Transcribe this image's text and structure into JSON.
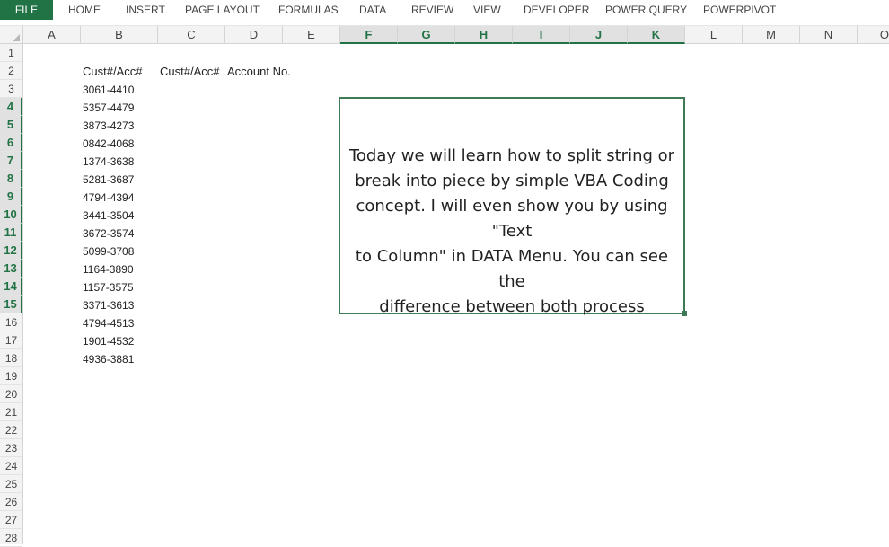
{
  "ribbon": {
    "tabs": [
      "FILE",
      "HOME",
      "INSERT",
      "PAGE LAYOUT",
      "FORMULAS",
      "DATA",
      "REVIEW",
      "VIEW",
      "DEVELOPER",
      "POWER QUERY",
      "POWERPIVOT"
    ]
  },
  "columns": [
    "A",
    "B",
    "C",
    "D",
    "E",
    "F",
    "G",
    "H",
    "I",
    "J",
    "K",
    "L",
    "M",
    "N",
    "O"
  ],
  "selected_columns": [
    "F",
    "G",
    "H",
    "I",
    "J",
    "K"
  ],
  "rows": [
    "1",
    "2",
    "3",
    "4",
    "5",
    "6",
    "7",
    "8",
    "9",
    "10",
    "11",
    "12",
    "13",
    "14",
    "15",
    "16",
    "17",
    "18",
    "19",
    "20",
    "21",
    "22",
    "23",
    "24",
    "25",
    "26",
    "27",
    "28"
  ],
  "selected_rows": [
    "4",
    "5",
    "6",
    "7",
    "8",
    "9",
    "10",
    "11",
    "12",
    "13",
    "14",
    "15"
  ],
  "headers": {
    "b2": "Cust#/Acc#",
    "c2": "Cust#/Acc#",
    "d2": "Account No."
  },
  "data_b": [
    "3061-4410",
    "5357-4479",
    "3873-4273",
    "0842-4068",
    "1374-3638",
    "5281-3687",
    "4794-4394",
    "3441-3504",
    "3672-3574",
    "5099-3708",
    "1164-3890",
    "1157-3575",
    "3371-3613",
    "4794-4513",
    "1901-4532",
    "4936-3881"
  ],
  "textbox": {
    "lines": [
      "Today we will learn how to split string or",
      "break into piece by simple VBA Coding",
      "concept. I will even show you by using \"Text",
      "to Column\" in DATA Menu. You can see the",
      "difference between both process"
    ]
  },
  "colors": {
    "accent": "#217346",
    "header_bg": "#f3f3f3"
  }
}
